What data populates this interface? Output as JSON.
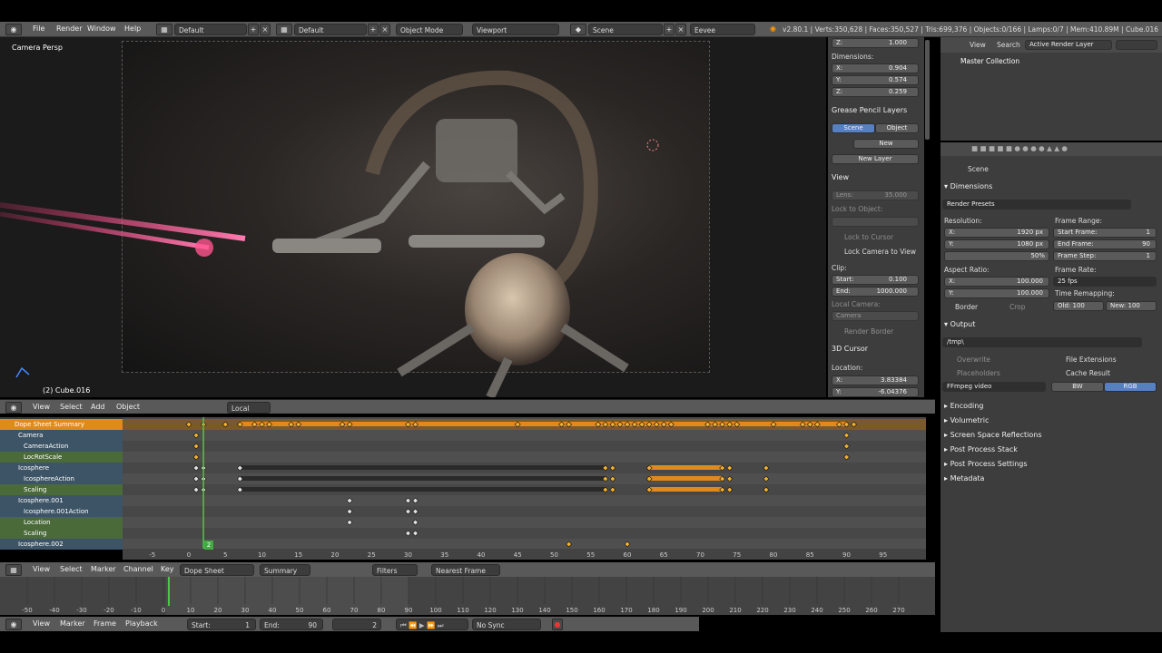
{
  "topbar": {
    "menus": [
      "File",
      "Render",
      "Window",
      "Help"
    ],
    "screen": "Default",
    "layout": "Default",
    "mode": "Object Mode",
    "viewport": "Viewport",
    "scene": "Scene",
    "engine": "Eevee",
    "stats": "v2.80.1 | Verts:350,628 | Faces:350,527 | Tris:699,376 | Objects:0/166 | Lamps:0/7 | Mem:410.89M | Cube.016"
  },
  "viewport": {
    "label": "Camera Persp",
    "object": "(2) Cube.016"
  },
  "npanel": {
    "z_label": "Z:",
    "z_value": "1.000",
    "dims_title": "Dimensions:",
    "dx": "0.904",
    "dy": "0.574",
    "dz": "0.259",
    "gp_title": "Grease Pencil Layers",
    "scene_btn": "Scene",
    "object_btn": "Object",
    "new_btn": "New",
    "new_layer": "New Layer",
    "view_title": "View",
    "lens_label": "Lens:",
    "lens_value": "35.000",
    "lock_obj": "Lock to Object:",
    "lock_cursor": "Lock to Cursor",
    "lock_cam": "Lock Camera to View",
    "clip_title": "Clip:",
    "clip_start_label": "Start:",
    "clip_start": "0.100",
    "clip_end_label": "End:",
    "clip_end": "1000.000",
    "local_cam": "Local Camera:",
    "camera": "Camera",
    "render_border": "Render Border",
    "cursor_title": "3D Cursor",
    "loc_title": "Location:",
    "cx": "3.83384",
    "cy": "-6.04376"
  },
  "outliner": {
    "view": "View",
    "search": "Search",
    "layer": "Active Render Layer",
    "collection": "Master Collection"
  },
  "props": {
    "scene": "Scene",
    "dimensions": "Dimensions",
    "presets": "Render Presets",
    "resolution": "Resolution:",
    "rx": "1920 px",
    "ry": "1080 px",
    "rpct": "50%",
    "frame_range": "Frame Range:",
    "start_frame_label": "Start Frame:",
    "start_frame": "1",
    "end_frame_label": "End Frame:",
    "end_frame": "90",
    "frame_step_label": "Frame Step:",
    "frame_step": "1",
    "aspect": "Aspect Ratio:",
    "ax": "100.000",
    "ay": "100.000",
    "frame_rate": "Frame Rate:",
    "fps": "25 fps",
    "border": "Border",
    "crop": "Crop",
    "time_remap": "Time Remapping:",
    "old_label": "Old:",
    "old": "100",
    "new_label": "New:",
    "new": "100",
    "output": "Output",
    "path": "/tmp\\",
    "overwrite": "Overwrite",
    "file_ext": "File Extensions",
    "placeholders": "Placeholders",
    "cache": "Cache Result",
    "format": "FFmpeg video",
    "bw": "BW",
    "rgb": "RGB",
    "sections": [
      "Encoding",
      "Volumetric",
      "Screen Space Reflections",
      "Post Process Stack",
      "Post Process Settings",
      "Metadata"
    ]
  },
  "dopesheet_header": {
    "menus": [
      "View",
      "Select",
      "Add",
      "Object"
    ],
    "space": "Local"
  },
  "channels": [
    "Dope Sheet Summary",
    "Camera",
    "CameraAction",
    "LocRotScale",
    "Icosphere",
    "IcosphereAction",
    "Scaling",
    "Icosphere.001",
    "Icosphere.001Action",
    "Location",
    "Scaling",
    "Icosphere.002"
  ],
  "ruler_labels": [
    "-5",
    "0",
    "5",
    "10",
    "15",
    "20",
    "25",
    "30",
    "35",
    "40",
    "45",
    "50",
    "55",
    "60",
    "65",
    "70",
    "75",
    "80",
    "85",
    "90",
    "95"
  ],
  "current_frame": "2",
  "ds_footer": {
    "menus": [
      "View",
      "Select",
      "Marker",
      "Channel",
      "Key"
    ],
    "mode": "Dope Sheet",
    "summary": "Summary",
    "filters": "Filters",
    "snap": "Nearest Frame"
  },
  "tl_labels": [
    "-50",
    "-40",
    "-30",
    "-20",
    "-10",
    "0",
    "10",
    "20",
    "30",
    "40",
    "50",
    "60",
    "70",
    "80",
    "90",
    "100",
    "110",
    "120",
    "130",
    "140",
    "150",
    "160",
    "170",
    "180",
    "190",
    "200",
    "210",
    "220",
    "230",
    "240",
    "250",
    "260",
    "270"
  ],
  "tl_footer": {
    "menus": [
      "View",
      "Marker",
      "Frame",
      "Playback"
    ],
    "start_label": "Start:",
    "start": "1",
    "end_label": "End:",
    "end": "90",
    "frame": "2",
    "sync": "No Sync"
  }
}
